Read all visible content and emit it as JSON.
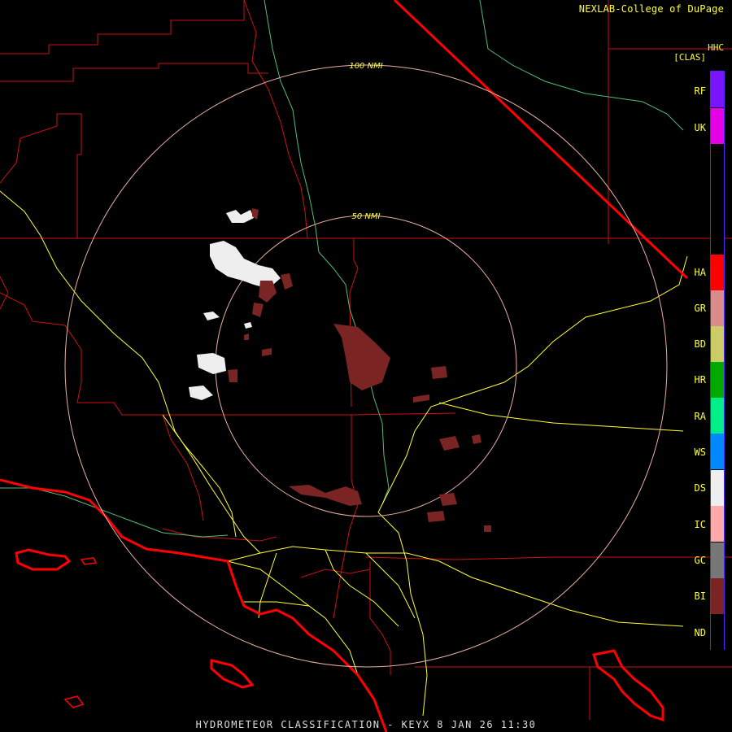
{
  "header": {
    "credit": "NEXLAB-College of DuPage",
    "product_code": "HHC",
    "units": "[CLAS]"
  },
  "range_rings": [
    {
      "label": "100 NMI"
    },
    {
      "label": "50 NMI"
    }
  ],
  "legend": [
    {
      "code": "RF",
      "color": "#7a14ff"
    },
    {
      "code": "UK",
      "color": "#e600e6"
    },
    {
      "code": "HA",
      "color": "#ff0000"
    },
    {
      "code": "GR",
      "color": "#d98c8c"
    },
    {
      "code": "BD",
      "color": "#cccc66"
    },
    {
      "code": "HR",
      "color": "#00aa00"
    },
    {
      "code": "RA",
      "color": "#00ee88"
    },
    {
      "code": "WS",
      "color": "#0088ff"
    },
    {
      "code": "DS",
      "color": "#eeeeee"
    },
    {
      "code": "IC",
      "color": "#ffaaaa"
    },
    {
      "code": "GC",
      "color": "#777777"
    },
    {
      "code": "BI",
      "color": "#7a2424"
    },
    {
      "code": "ND",
      "color": "#000000"
    }
  ],
  "footer": {
    "title": "HYDROMETEOR CLASSIFICATION - KEYX 8 JAN 26 11:30"
  },
  "colors": {
    "background": "#000000",
    "text": "#ffff33",
    "county_lines": "#cc1111",
    "coastline": "#ff0000",
    "roads": "#ffff33",
    "rivers": "#55bb77",
    "rings": "#e8b0a0"
  }
}
